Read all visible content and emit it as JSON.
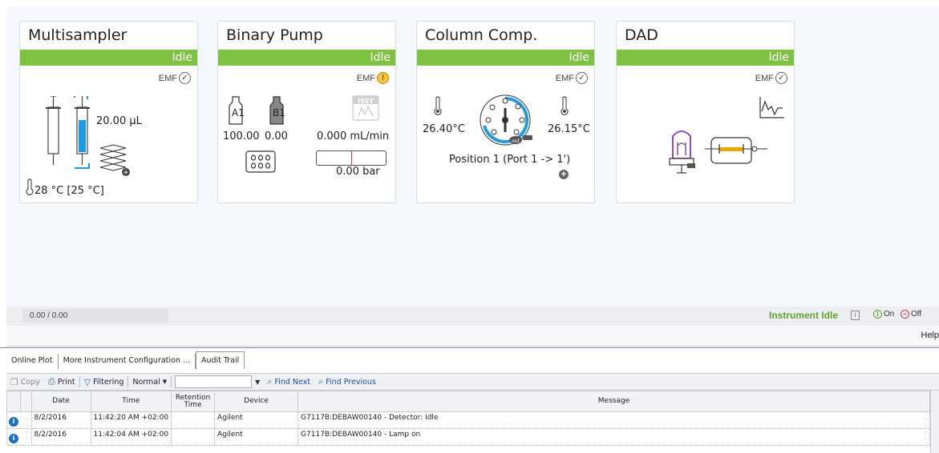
{
  "modules": {
    "multisampler": {
      "title": "Multisampler",
      "status": "Idle",
      "emf_label": "EMF",
      "emf_symbol": "✓",
      "volume": "20.00 µL",
      "temperature": "28 °C [25 °C]"
    },
    "binary_pump": {
      "title": "Binary Pump",
      "status": "Idle",
      "emf_label": "EMF",
      "emf_symbol": "!",
      "bottle_a": "A1",
      "bottle_b": "B1",
      "percent_a": "100.00",
      "percent_b": "0.00",
      "iset_label": "ISET",
      "flow": "0.000 mL/min",
      "pressure": "0.00 bar",
      "pressure_fraction": 0.0
    },
    "column_comp": {
      "title": "Column Comp.",
      "status": "Idle",
      "emf_label": "EMF",
      "emf_symbol": "✓",
      "temp_left": "26.40°C",
      "temp_right": "26.15°C",
      "position": "Position 1 (Port 1 -> 1')",
      "valve_out_label": "out"
    },
    "dad": {
      "title": "DAD",
      "status": "Idle",
      "emf_label": "EMF",
      "emf_symbol": "✓"
    }
  },
  "statusbar": {
    "progress": "0.00 / 0.00",
    "instrument_status": "Instrument Idle",
    "info_symbol": "i",
    "on_label": "On",
    "on_symbol": "I",
    "off_label": "Off",
    "off_symbol": "−",
    "help": "Help"
  },
  "tabs": [
    "Online Plot",
    "More Instrument Configuration ...",
    "Audit Trail"
  ],
  "toolbar": {
    "copy": "Copy",
    "print": "Print",
    "filtering": "Filtering",
    "normal": "Normal",
    "find_next": "Find Next",
    "find_previous": "Find Previous"
  },
  "audit": {
    "columns": [
      "Date",
      "Time",
      "Retention Time",
      "Device",
      "Message"
    ],
    "rows": [
      {
        "date": "8/2/2016",
        "time": "11:42:20 AM +02:00",
        "rt": "",
        "device": "Agilent",
        "message": "G7117B:DEBAW00140 - Detector: Idle"
      },
      {
        "date": "8/2/2016",
        "time": "11:42:04 AM +02:00",
        "rt": "",
        "device": "Agilent",
        "message": "G7117B:DEBAW00140 - Lamp on"
      }
    ]
  },
  "colors": {
    "status_green": "#7ec242",
    "idle_text_green": "#5fa52c",
    "syringe_blue": "#1e9be0",
    "valve_blue": "#1e9be0",
    "dad_lamp_purple": "#8a4fb8",
    "dad_flowcell_orange": "#f0a500"
  }
}
